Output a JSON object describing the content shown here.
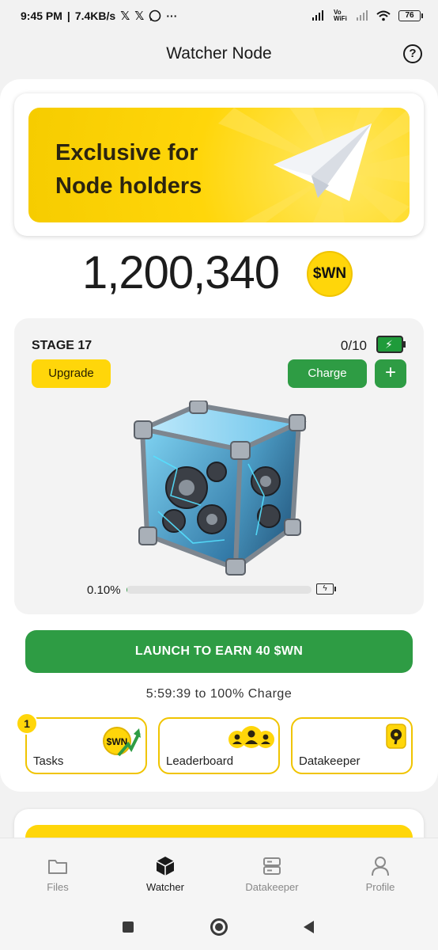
{
  "status_bar": {
    "time": "9:45 PM",
    "speed": "7.4KB/s",
    "app_icons": [
      "X",
      "X",
      "WhatsApp"
    ],
    "more": "···",
    "signal_text": "Vo WiFi",
    "battery": "76"
  },
  "header": {
    "title": "Watcher Node",
    "help_icon": "question-circle-icon"
  },
  "banner": {
    "line1": "Exclusive for",
    "line2": "Node holders",
    "icon": "telegram-plane-icon",
    "bg_color": "#ffd60a"
  },
  "balance": {
    "value": "1,200,340",
    "token": "$WN"
  },
  "node": {
    "stage": "STAGE 17",
    "charges": "0/10",
    "upgrade_label": "Upgrade",
    "charge_label": "Charge",
    "plus_label": "+",
    "progress_label": "0.10%",
    "progress_value": 0.1
  },
  "launch": {
    "label": "LAUNCH TO EARN 40 $WN",
    "timer": "5:59:39  to 100% Charge"
  },
  "tiles": [
    {
      "label": "Tasks",
      "badge": "1",
      "icon": "wn-coin-arrow-icon",
      "coin_text": "$WN"
    },
    {
      "label": "Leaderboard",
      "icon": "users-group-icon"
    },
    {
      "label": "Datakeeper",
      "icon": "hard-drive-icon"
    }
  ],
  "bottom_nav": [
    {
      "label": "Files",
      "icon": "folder-icon",
      "active": false
    },
    {
      "label": "Watcher",
      "icon": "cube-icon",
      "active": true
    },
    {
      "label": "Datakeeper",
      "icon": "server-icon",
      "active": false
    },
    {
      "label": "Profile",
      "icon": "user-icon",
      "active": false
    }
  ],
  "colors": {
    "accent_yellow": "#ffd60a",
    "accent_green": "#2e9c44",
    "background": "#f2f2f2"
  }
}
